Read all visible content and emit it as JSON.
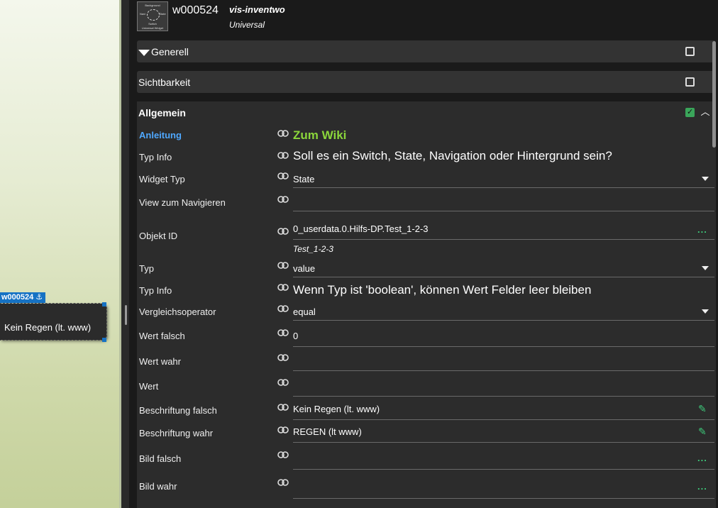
{
  "canvas": {
    "widget_id_label": "w000524",
    "anchor_icon": "anchor-icon",
    "widget_text": "Kein Regen (lt. www)"
  },
  "header": {
    "widget_id": "w000524",
    "widget_set": "vis-inventwo",
    "widget_type": "Universal",
    "thumbnail_lines": [
      "Background",
      "Navi",
      "State",
      "Switch",
      "Universal Widget"
    ]
  },
  "groups": {
    "generell": "Generell",
    "sichtbarkeit": "Sichtbarkeit",
    "allgemein": "Allgemein"
  },
  "fields": [
    {
      "label": "Anleitung",
      "value": "Zum Wiki"
    },
    {
      "label": "Typ Info",
      "value": "Soll es ein Switch, State, Navigation oder Hintergrund sein?"
    },
    {
      "label": "Widget Typ",
      "value": "State"
    },
    {
      "label": "View zum Navigieren",
      "value": ""
    },
    {
      "label": "Objekt ID",
      "value": "0_userdata.0.Hilfs-DP.Test_1-2-3",
      "sub": "Test_1-2-3"
    },
    {
      "label": "Typ",
      "value": "value"
    },
    {
      "label": "Typ Info",
      "value": "Wenn Typ ist 'boolean', können Wert Felder leer bleiben"
    },
    {
      "label": "Vergleichsoperator",
      "value": "equal"
    },
    {
      "label": "Wert falsch",
      "value": "0"
    },
    {
      "label": "Wert wahr",
      "value": ""
    },
    {
      "label": "Wert",
      "value": ""
    },
    {
      "label": "Beschriftung falsch",
      "value": "Kein Regen (lt. www)"
    },
    {
      "label": "Beschriftung wahr",
      "value": "REGEN (lt www)"
    },
    {
      "label": "Bild falsch",
      "value": ""
    },
    {
      "label": "Bild wahr",
      "value": ""
    }
  ],
  "colors": {
    "accent_blue": "#1672c4",
    "label_blue": "#4fa8ff",
    "wiki_green": "#8bd63b",
    "action_green": "#3ec97a"
  }
}
